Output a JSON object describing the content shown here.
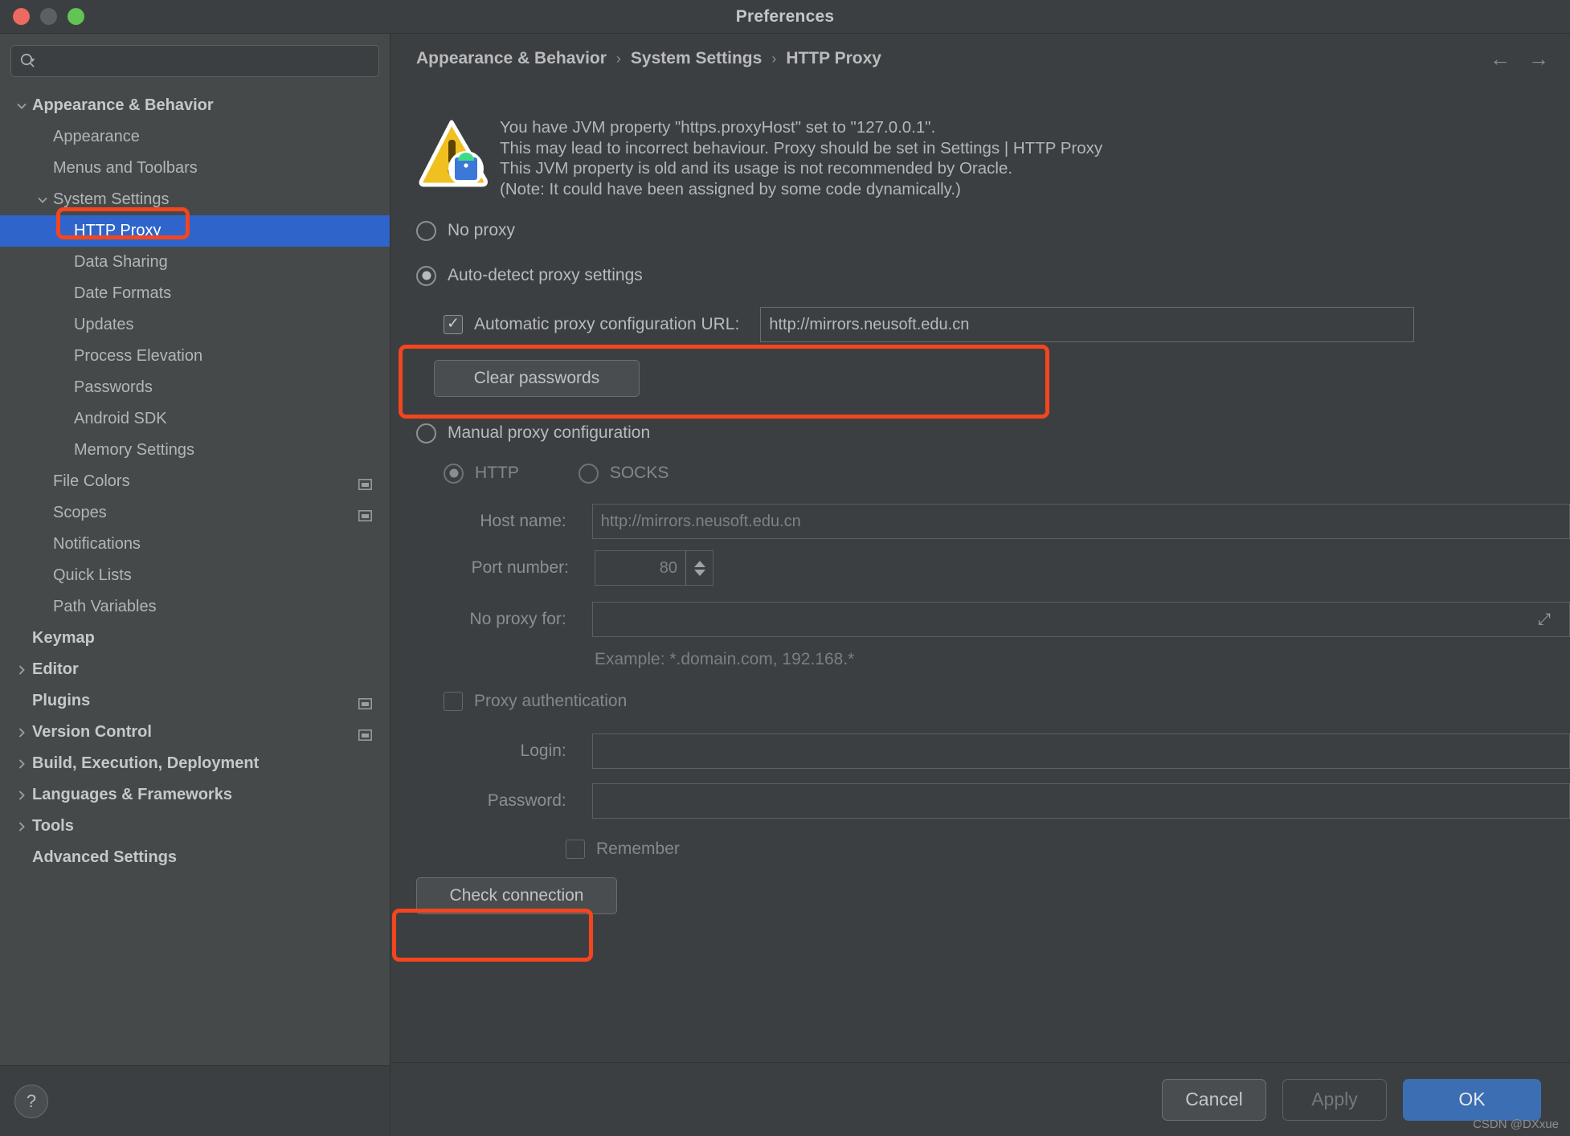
{
  "window": {
    "title": "Preferences",
    "traffic_lights": [
      "close",
      "minimize",
      "zoom"
    ]
  },
  "sidebar": {
    "search": {
      "value": "",
      "placeholder": ""
    },
    "items": [
      {
        "label": "Appearance & Behavior",
        "indent": 0,
        "twisty": "down",
        "bold": true,
        "selected": false,
        "badge": false
      },
      {
        "label": "Appearance",
        "indent": 1,
        "twisty": "",
        "bold": false,
        "selected": false,
        "badge": false
      },
      {
        "label": "Menus and Toolbars",
        "indent": 1,
        "twisty": "",
        "bold": false,
        "selected": false,
        "badge": false
      },
      {
        "label": "System Settings",
        "indent": 1,
        "twisty": "down",
        "bold": false,
        "selected": false,
        "badge": false
      },
      {
        "label": "HTTP Proxy",
        "indent": 2,
        "twisty": "",
        "bold": false,
        "selected": true,
        "badge": false
      },
      {
        "label": "Data Sharing",
        "indent": 2,
        "twisty": "",
        "bold": false,
        "selected": false,
        "badge": false
      },
      {
        "label": "Date Formats",
        "indent": 2,
        "twisty": "",
        "bold": false,
        "selected": false,
        "badge": false
      },
      {
        "label": "Updates",
        "indent": 2,
        "twisty": "",
        "bold": false,
        "selected": false,
        "badge": false
      },
      {
        "label": "Process Elevation",
        "indent": 2,
        "twisty": "",
        "bold": false,
        "selected": false,
        "badge": false
      },
      {
        "label": "Passwords",
        "indent": 2,
        "twisty": "",
        "bold": false,
        "selected": false,
        "badge": false
      },
      {
        "label": "Android SDK",
        "indent": 2,
        "twisty": "",
        "bold": false,
        "selected": false,
        "badge": false
      },
      {
        "label": "Memory Settings",
        "indent": 2,
        "twisty": "",
        "bold": false,
        "selected": false,
        "badge": false
      },
      {
        "label": "File Colors",
        "indent": 1,
        "twisty": "",
        "bold": false,
        "selected": false,
        "badge": true
      },
      {
        "label": "Scopes",
        "indent": 1,
        "twisty": "",
        "bold": false,
        "selected": false,
        "badge": true
      },
      {
        "label": "Notifications",
        "indent": 1,
        "twisty": "",
        "bold": false,
        "selected": false,
        "badge": false
      },
      {
        "label": "Quick Lists",
        "indent": 1,
        "twisty": "",
        "bold": false,
        "selected": false,
        "badge": false
      },
      {
        "label": "Path Variables",
        "indent": 1,
        "twisty": "",
        "bold": false,
        "selected": false,
        "badge": false
      },
      {
        "label": "Keymap",
        "indent": 0,
        "twisty": "",
        "bold": true,
        "selected": false,
        "badge": false
      },
      {
        "label": "Editor",
        "indent": 0,
        "twisty": "right",
        "bold": true,
        "selected": false,
        "badge": false
      },
      {
        "label": "Plugins",
        "indent": 0,
        "twisty": "",
        "bold": true,
        "selected": false,
        "badge": true
      },
      {
        "label": "Version Control",
        "indent": 0,
        "twisty": "right",
        "bold": true,
        "selected": false,
        "badge": true
      },
      {
        "label": "Build, Execution, Deployment",
        "indent": 0,
        "twisty": "right",
        "bold": true,
        "selected": false,
        "badge": false
      },
      {
        "label": "Languages & Frameworks",
        "indent": 0,
        "twisty": "right",
        "bold": true,
        "selected": false,
        "badge": false
      },
      {
        "label": "Tools",
        "indent": 0,
        "twisty": "right",
        "bold": true,
        "selected": false,
        "badge": false
      },
      {
        "label": "Advanced Settings",
        "indent": 0,
        "twisty": "",
        "bold": true,
        "selected": false,
        "badge": false
      }
    ],
    "help_label": "?"
  },
  "breadcrumb": {
    "part1": "Appearance & Behavior",
    "part2": "System Settings",
    "part3": "HTTP Proxy",
    "separator": "›",
    "back_arrow": "←",
    "forward_arrow": "→"
  },
  "warning": {
    "line1": "You have JVM property \"https.proxyHost\" set to \"127.0.0.1\".",
    "line2": "This may lead to incorrect behaviour. Proxy should be set in Settings | HTTP Proxy",
    "line3": "This JVM property is old and its usage is not recommended by Oracle.",
    "line4": "(Note: It could have been assigned by some code dynamically.)"
  },
  "proxy": {
    "no_proxy_label": "No proxy",
    "no_proxy_selected": false,
    "auto_detect_label": "Auto-detect proxy settings",
    "auto_detect_selected": true,
    "pac_checkbox_label": "Automatic proxy configuration URL:",
    "pac_checked": true,
    "pac_url_value": "http://mirrors.neusoft.edu.cn",
    "clear_passwords_label": "Clear passwords",
    "manual_label": "Manual proxy configuration",
    "manual_selected": false,
    "http_label": "HTTP",
    "http_selected": true,
    "socks_label": "SOCKS",
    "socks_selected": false,
    "host_name_label": "Host name:",
    "host_name_value": "http://mirrors.neusoft.edu.cn",
    "port_number_label": "Port number:",
    "port_number_value": "80",
    "no_proxy_for_label": "No proxy for:",
    "no_proxy_for_value": "",
    "example_hint": "Example: *.domain.com, 192.168.*",
    "proxy_auth_label": "Proxy authentication",
    "proxy_auth_checked": false,
    "login_label": "Login:",
    "login_value": "",
    "password_label": "Password:",
    "password_value": "",
    "remember_label": "Remember",
    "remember_checked": false,
    "check_connection_label": "Check connection"
  },
  "footer": {
    "cancel_label": "Cancel",
    "apply_label": "Apply",
    "ok_label": "OK",
    "watermark": "CSDN @DXxue"
  },
  "colors": {
    "accent_selected": "#2f65ca",
    "ok_button": "#3c6eb4",
    "annotation_red": "#f4451e",
    "warning_yellow": "#f0c020"
  }
}
